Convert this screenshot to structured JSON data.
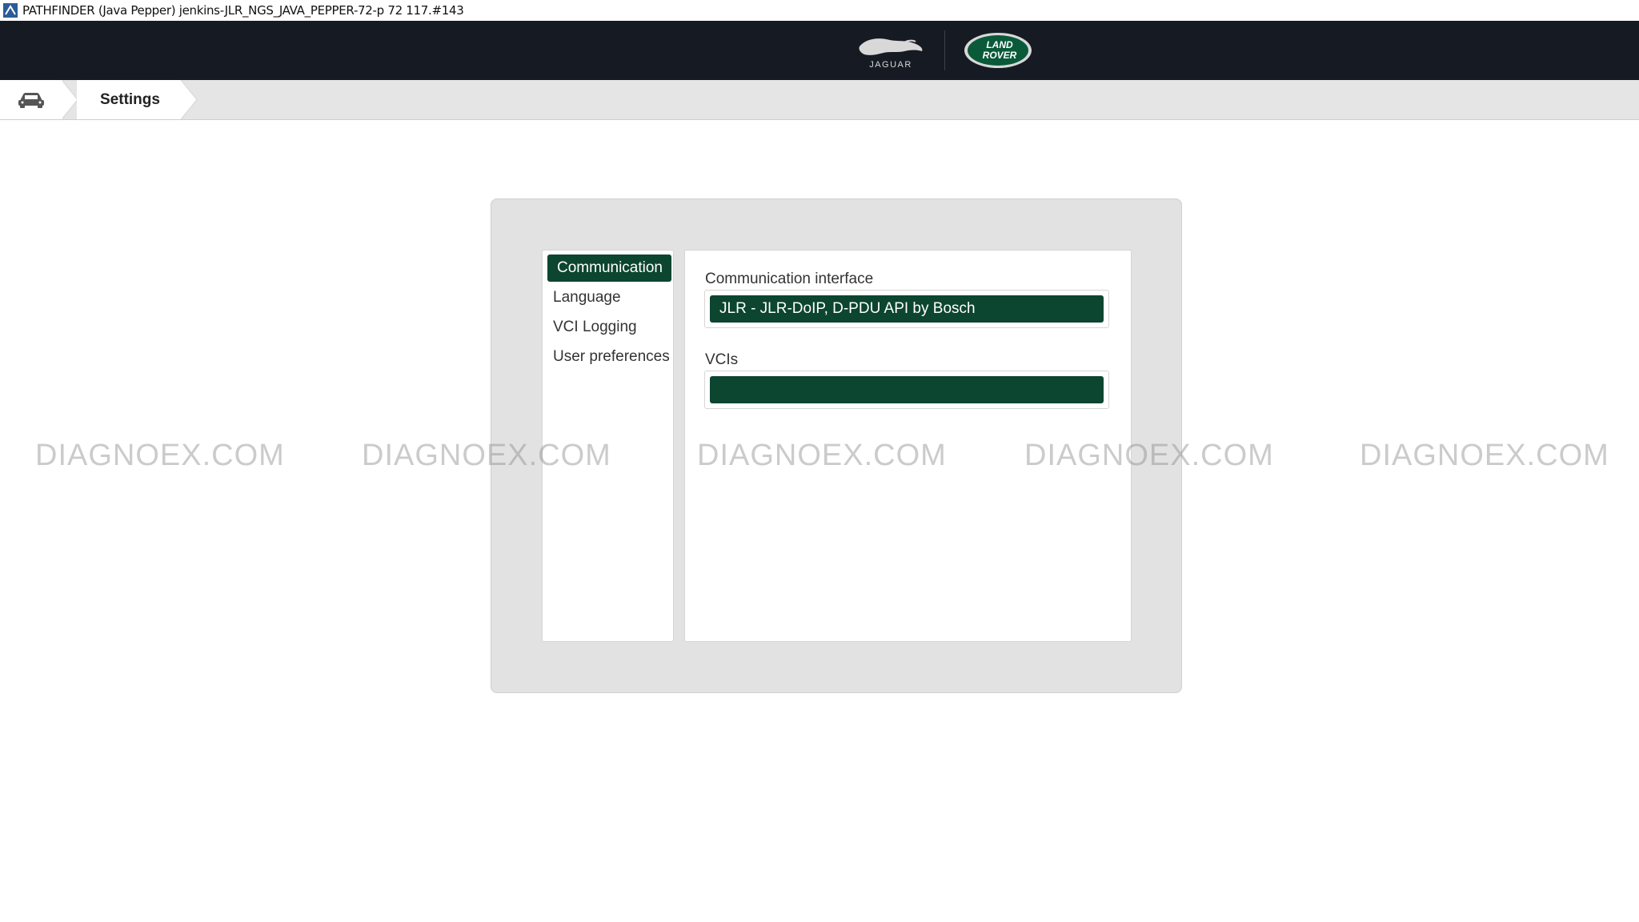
{
  "window": {
    "title": "PATHFINDER (Java Pepper) jenkins-JLR_NGS_JAVA_PEPPER-72-p 72 117.#143",
    "app_icon": "pathfinder-app-icon"
  },
  "brand": {
    "jaguar_text": "JAGUAR",
    "landrover_line1": "LAND",
    "landrover_line2": "ROVER",
    "colors": {
      "header_bg": "#161a23",
      "landrover_green": "#0a5a3a"
    }
  },
  "breadcrumb": {
    "home_icon": "car-icon",
    "current": "Settings"
  },
  "settings": {
    "nav_items": [
      {
        "label": "Communication",
        "active": true
      },
      {
        "label": "Language",
        "active": false
      },
      {
        "label": "VCI Logging",
        "active": false
      },
      {
        "label": "User preferences",
        "active": false
      }
    ],
    "communication_interface": {
      "label": "Communication interface",
      "selected": "JLR - JLR-DoIP, D-PDU API by Bosch"
    },
    "vcis": {
      "label": "VCIs",
      "selected": ""
    },
    "colors": {
      "accent": "#0c4530",
      "panel_bg": "#e2e2e2"
    }
  },
  "watermark": {
    "text": "DIAGNOEX.COM",
    "items": [
      "DIAGNOEX.COM",
      "DIAGNOEX.COM",
      "DIAGNOEX.COM",
      "DIAGNOEX.COM",
      "DIAGNOEX.COM"
    ]
  }
}
